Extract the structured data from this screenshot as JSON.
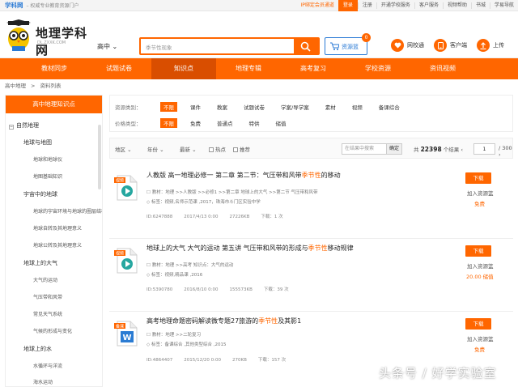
{
  "topbar": {
    "site": "学科网",
    "slogan": "– 权威专业教育资源门户",
    "ip": "IP绑定会员通道",
    "login": "登录",
    "register": "注册",
    "links": [
      "开通学校服务",
      "客户服务",
      "视频帮助",
      "书城",
      "学易导航"
    ]
  },
  "header": {
    "logo_name": "地理学科网",
    "logo_url": "DL.ZXXK.COM",
    "grade": "高中",
    "search_placeholder": "季节性现象",
    "cart_label": "资源篮",
    "cart_count": "0",
    "quick": [
      "网校通",
      "客户端",
      "上传"
    ]
  },
  "nav": [
    "教材同步",
    "试题试卷",
    "知识点",
    "地理专辑",
    "高考复习",
    "学校资源",
    "资讯视频"
  ],
  "breadcrumb": [
    "高中地理",
    "资料列表"
  ],
  "sidebar": {
    "title": "高中地理知识点",
    "root": "自然地理",
    "nodes": [
      "地球与地图",
      "地球和地球仪",
      "地图基础知识",
      "宇宙中的地球",
      "地球的宇宙环境与地球的圈层结构",
      "地球自转及其地理意义",
      "地球公转及其地理意义",
      "地球上的大气",
      "大气的运动",
      "气压带和风带",
      "常见天气系统",
      "气候的形成与变化",
      "地球上的水",
      "水循环与洋流",
      "海水运动"
    ]
  },
  "filters": {
    "type_label": "资源类别：",
    "types": [
      "不限",
      "课件",
      "教案",
      "试题试卷",
      "学案/导学案",
      "素材",
      "视频",
      "备课综合"
    ],
    "price_label": "价格类型：",
    "prices": [
      "不限",
      "免费",
      "普通点",
      "特供",
      "储值"
    ]
  },
  "sortbar": {
    "region": "地区",
    "year": "年份",
    "latest": "最新",
    "hot": "热点",
    "recommend": "推荐",
    "search_placeholder": "在结果中搜索",
    "confirm": "确定",
    "total_pre": "共",
    "total": "22398",
    "total_post": "个结果",
    "page": "1",
    "pages": "/ 300"
  },
  "results": [
    {
      "badge": "视频",
      "title_pre": "人教版 高一地理必修一 第二章 第二节：气压带和风带",
      "title_hl": "季节性",
      "title_post": "的移动",
      "m1": "教材：地理 >>人教版 >>必修1 >>第二章 地球上的大气 >>第二节 气压带和风带",
      "m2": "标签：视频,名师示范课 ,2017，珠海市斗门区实验中学",
      "id": "ID:6247888",
      "date": "2017/4/13 0:00",
      "size": "27226KB",
      "dl": "下载：1 次",
      "download": "下载",
      "addcart": "加入资源篮",
      "price": "免费"
    },
    {
      "badge": "视频",
      "title_pre": "地球上的大气 大气的运动 第五讲 气压带和风带的形成与",
      "title_hl": "季节性",
      "title_post": "移动规律",
      "m1": "教材：地理 >>高考 知识点：大气的运动",
      "m2": "标签：视频,精品课 ,2016",
      "id": "ID:5390780",
      "date": "2016/8/10 0:00",
      "size": "155573KB",
      "dl": "下载：39 次",
      "download": "下载",
      "addcart": "加入资源篮",
      "price": "20.00 储值"
    },
    {
      "badge": "备课",
      "title_pre": "高考地理命题密码解读微专题27旅游的",
      "title_hl": "季节性",
      "title_post": "及其影1",
      "m1": "教材：地理 >>二轮复习",
      "m2": "标签：备课综合 ,其他类型综合 ,2015",
      "id": "ID:4864407",
      "date": "2015/12/20 0:00",
      "size": "270KB",
      "dl": "下载：157 次",
      "download": "下载",
      "addcart": "加入资源篮",
      "price": "免费"
    }
  ],
  "watermark": "头条号 / 好学实验室"
}
